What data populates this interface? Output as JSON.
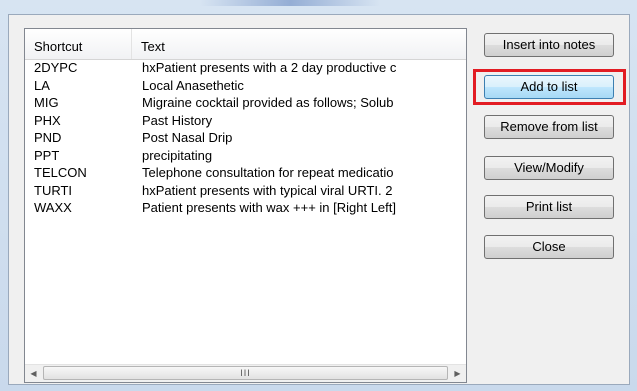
{
  "list": {
    "columns": {
      "shortcut": "Shortcut",
      "text": "Text"
    },
    "rows": [
      {
        "shortcut": "2DYPC",
        "text": "hxPatient presents with a 2 day productive c"
      },
      {
        "shortcut": "LA",
        "text": "Local Anasethetic"
      },
      {
        "shortcut": "MIG",
        "text": "Migraine cocktail provided as follows;  Solub"
      },
      {
        "shortcut": "PHX",
        "text": "Past History"
      },
      {
        "shortcut": "PND",
        "text": "Post Nasal Drip"
      },
      {
        "shortcut": "PPT",
        "text": "precipitating"
      },
      {
        "shortcut": "TELCON",
        "text": "Telephone consultation for repeat medicatio"
      },
      {
        "shortcut": "TURTI",
        "text": "hxPatient presents with typical viral URTI. 2"
      },
      {
        "shortcut": "WAXX",
        "text": "Patient presents with wax +++ in [Right Left]"
      }
    ],
    "scroll_thumb_grip": "III"
  },
  "buttons": {
    "insert": "Insert into notes",
    "add": "Add to list",
    "remove": "Remove from list",
    "view": "View/Modify",
    "print": "Print list",
    "close": "Close"
  },
  "colors": {
    "highlight": "#e21c23",
    "focus_border": "#3c7fb1"
  }
}
